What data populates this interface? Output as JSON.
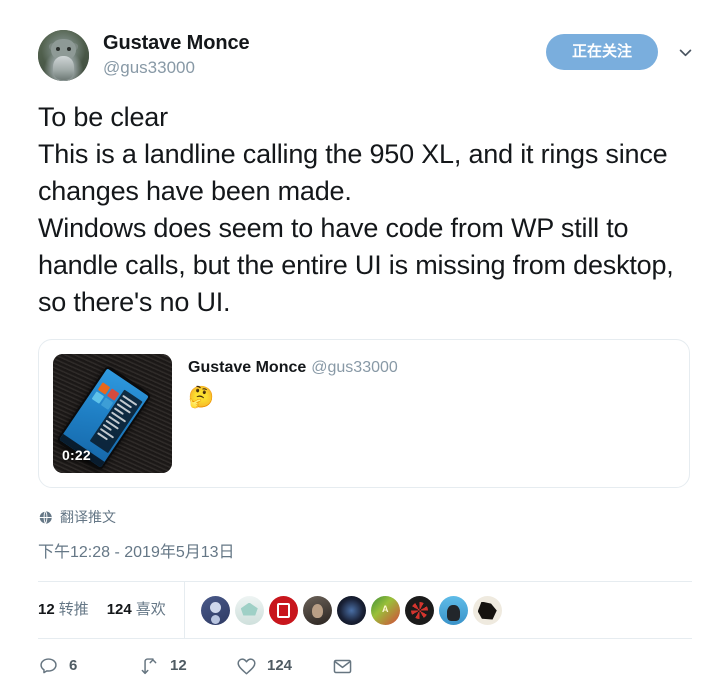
{
  "tweet": {
    "author": {
      "display_name": "Gustave Monce",
      "handle": "@gus33000",
      "avatar_icon": "owl-avatar"
    },
    "follow_button": {
      "label": "正在关注",
      "accent_color": "#7aaedd",
      "caret_icon": "chevron-down-icon"
    },
    "body": "To be clear\nThis is a landline calling the 950 XL, and it rings since changes have been made.\nWindows does seem to have code from WP still to handle calls, but the entire UI is missing from desktop, so there's no UI.",
    "quoted_tweet": {
      "author_name": "Gustave Monce",
      "author_handle": "@gus33000",
      "text": "🤔",
      "media": {
        "type": "video-thumbnail",
        "duration": "0:22",
        "description": "Lumia phone running Windows 10 desktop on dark ribbed fabric"
      }
    },
    "translate": {
      "label": "翻译推文",
      "icon": "globe-icon"
    },
    "timestamp": "下午12:28 - 2019年5月13日",
    "stats": {
      "retweets_count": "12",
      "retweets_label": "转推",
      "likes_count": "124",
      "likes_label": "喜欢"
    },
    "likers": [
      {
        "name": "liker-1"
      },
      {
        "name": "liker-2"
      },
      {
        "name": "liker-3"
      },
      {
        "name": "liker-4"
      },
      {
        "name": "liker-5"
      },
      {
        "name": "liker-6"
      },
      {
        "name": "liker-7"
      },
      {
        "name": "liker-8"
      },
      {
        "name": "liker-9"
      }
    ],
    "actions": {
      "reply": {
        "icon": "reply-icon",
        "count": "6"
      },
      "retweet": {
        "icon": "retweet-icon",
        "count": "12"
      },
      "like": {
        "icon": "heart-icon",
        "count": "124"
      },
      "share": {
        "icon": "envelope-icon",
        "count": ""
      }
    }
  }
}
